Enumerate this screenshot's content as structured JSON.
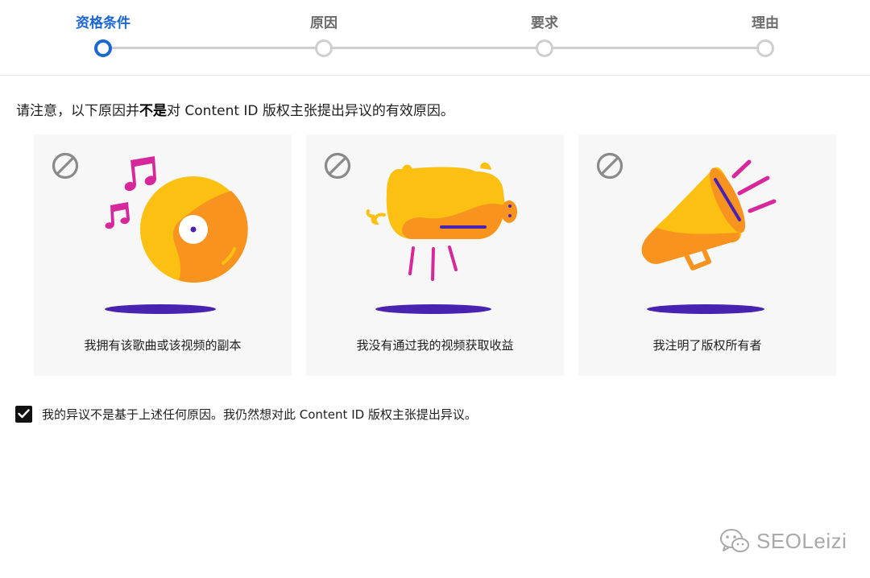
{
  "stepper": {
    "steps": [
      {
        "label": "资格条件",
        "active": true
      },
      {
        "label": "原因",
        "active": false
      },
      {
        "label": "要求",
        "active": false
      },
      {
        "label": "理由",
        "active": false
      }
    ]
  },
  "notice": {
    "before": "请注意，以下原因并",
    "emphasis": "不是",
    "after": "对 Content ID 版权主张提出异议的有效原因。"
  },
  "cards": [
    {
      "caption": "我拥有该歌曲或该视频的副本",
      "icon": "no-entry-icon",
      "illustration": "music-disc-illustration"
    },
    {
      "caption": "我没有通过我的视频获取收益",
      "icon": "no-entry-icon",
      "illustration": "piggy-bank-illustration"
    },
    {
      "caption": "我注明了版权所有者",
      "icon": "no-entry-icon",
      "illustration": "megaphone-illustration"
    }
  ],
  "agree": {
    "checked": true,
    "text": "我的异议不是基于上述任何原因。我仍然想对此 Content ID 版权主张提出异议。"
  },
  "watermark": {
    "text": "SEOLeizi",
    "icon": "wechat-icon"
  },
  "colors": {
    "accent": "#1a66d4",
    "inactive": "#cfcfcf",
    "card_bg": "#f7f7f7",
    "yellow": "#fbc012",
    "orange": "#f7931e",
    "magenta": "#d6289b",
    "purple": "#4a22b2"
  }
}
